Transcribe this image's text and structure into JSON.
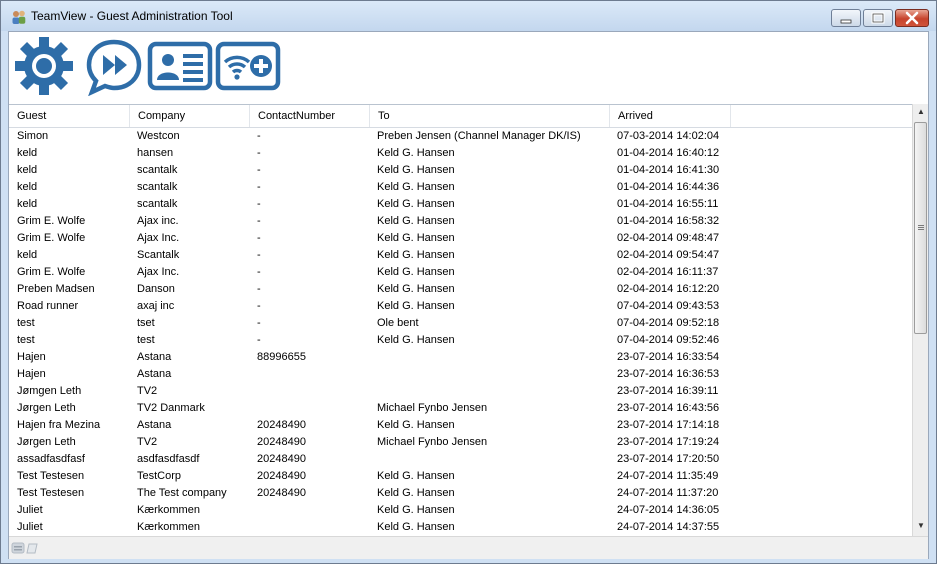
{
  "window": {
    "title": "TeamView - Guest Administration Tool",
    "icons": {
      "app": "people-icon",
      "minimize": "minimize-icon",
      "maximize": "maximize-icon",
      "close": "close-icon"
    }
  },
  "toolbar": {
    "buttons": [
      {
        "icon": "gear-icon"
      },
      {
        "icon": "fast-forward-chat-icon"
      },
      {
        "icon": "contact-card-icon"
      },
      {
        "icon": "wifi-add-icon"
      }
    ],
    "accent_color": "#2e6da8"
  },
  "grid": {
    "columns": [
      "Guest",
      "Company",
      "ContactNumber",
      "To",
      "Arrived"
    ],
    "rows": [
      [
        "Simon",
        "Westcon",
        "-",
        "Preben Jensen (Channel Manager DK/IS)",
        "07-03-2014 14:02:04"
      ],
      [
        "keld",
        "hansen",
        "-",
        "Keld G. Hansen",
        "01-04-2014 16:40:12"
      ],
      [
        "keld",
        "scantalk",
        "-",
        "Keld G. Hansen",
        "01-04-2014 16:41:30"
      ],
      [
        "keld",
        "scantalk",
        "-",
        "Keld G. Hansen",
        "01-04-2014 16:44:36"
      ],
      [
        "keld",
        "scantalk",
        "-",
        "Keld G. Hansen",
        "01-04-2014 16:55:11"
      ],
      [
        "Grim E. Wolfe",
        "Ajax inc.",
        "-",
        "Keld G. Hansen",
        "01-04-2014 16:58:32"
      ],
      [
        "Grim E. Wolfe",
        "Ajax Inc.",
        "-",
        "Keld G. Hansen",
        "02-04-2014 09:48:47"
      ],
      [
        "keld",
        "Scantalk",
        "-",
        "Keld G. Hansen",
        "02-04-2014 09:54:47"
      ],
      [
        "Grim E. Wolfe",
        "Ajax Inc.",
        "-",
        "Keld G. Hansen",
        "02-04-2014 16:11:37"
      ],
      [
        "Preben Madsen",
        "Danson",
        "-",
        "Keld G. Hansen",
        "02-04-2014 16:12:20"
      ],
      [
        "Road runner",
        "axaj inc",
        "-",
        "Keld G. Hansen",
        "07-04-2014 09:43:53"
      ],
      [
        "test",
        "tset",
        "-",
        "Ole bent",
        "07-04-2014 09:52:18"
      ],
      [
        "test",
        "test",
        "-",
        "Keld G. Hansen",
        "07-04-2014 09:52:46"
      ],
      [
        "Hajen",
        "Astana",
        "88996655",
        "",
        "23-07-2014 16:33:54"
      ],
      [
        "Hajen",
        "Astana",
        "",
        "",
        "23-07-2014 16:36:53"
      ],
      [
        "Jømgen Leth",
        "TV2",
        "",
        "",
        "23-07-2014 16:39:11"
      ],
      [
        "Jørgen Leth",
        "TV2 Danmark",
        "",
        "Michael Fynbo Jensen",
        "23-07-2014 16:43:56"
      ],
      [
        "Hajen fra Mezina",
        "Astana",
        "20248490",
        "Keld G. Hansen",
        "23-07-2014 17:14:18"
      ],
      [
        "Jørgen Leth",
        "TV2",
        "20248490",
        "Michael Fynbo Jensen",
        "23-07-2014 17:19:24"
      ],
      [
        "assadfasdfasf",
        "asdfasdfasdf",
        "20248490",
        "",
        "23-07-2014 17:20:50"
      ],
      [
        "Test Testesen",
        "TestCorp",
        "20248490",
        "Keld G. Hansen",
        "24-07-2014 11:35:49"
      ],
      [
        "Test Testesen",
        "The Test company",
        "20248490",
        "Keld G. Hansen",
        "24-07-2014 11:37:20"
      ],
      [
        "Juliet",
        "Kærkommen",
        "",
        "Keld G. Hansen",
        "24-07-2014 14:36:05"
      ],
      [
        "Juliet",
        "Kærkommen",
        "",
        "Keld G. Hansen",
        "24-07-2014 14:37:55"
      ]
    ]
  },
  "scrollbar": {
    "up": "▲",
    "down": "▼"
  },
  "statusbar": {
    "icon": "status-icon"
  }
}
